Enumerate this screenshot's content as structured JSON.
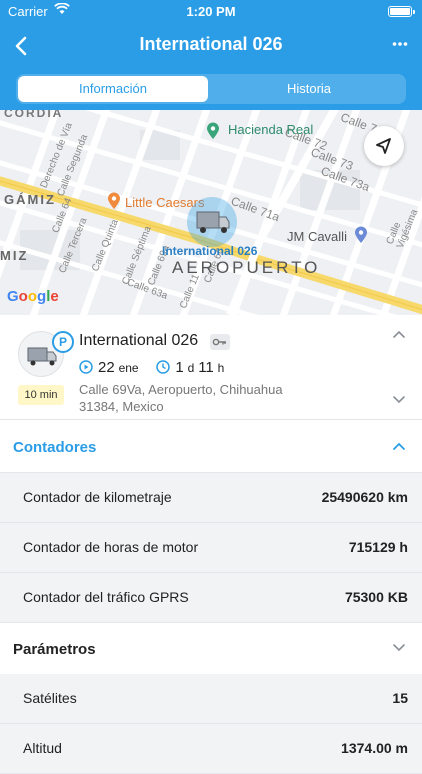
{
  "status_bar": {
    "carrier": "Carrier",
    "time": "1:20 PM"
  },
  "nav": {
    "title": "International 026",
    "back_icon": "chevron-left-icon",
    "more_icon": "ellipsis-icon"
  },
  "tabs": [
    {
      "label": "Información",
      "active": true
    },
    {
      "label": "Historia",
      "active": false
    }
  ],
  "map": {
    "streets": [
      "CORDIA",
      "Calle 7",
      "Calle 73",
      "Calle 71a",
      "Calle 72",
      "Calle 73a",
      "Derecho de Vía",
      "Calle Segunda",
      "Calle Tercera",
      "Calle Quinta",
      "Calle Séptima",
      "Calle 69a",
      "Calle 63a",
      "Calle 64",
      "Calle 67a",
      "Calle 65",
      "Calle 66",
      "Calle 11",
      "Calle Vigésima",
      "GÁMIZ",
      "MIZ"
    ],
    "places": {
      "hacienda": "Hacienda Real",
      "little_caesars": "Little Caesars",
      "jm_cavalli": "JM Cavalli"
    },
    "area": "AEROPUERTO",
    "vehicle_label": "International 026",
    "provider": "Google"
  },
  "vehicle": {
    "name": "International 026",
    "parking_badge": "P",
    "age_badge": "10 min",
    "date_day": "22",
    "date_month": "ene",
    "duration_days": "1",
    "duration_days_unit": "d",
    "duration_hours": "11",
    "duration_hours_unit": "h",
    "address_line1": "Calle 69Va, Aeropuerto, Chihuahua",
    "address_line2": "31384, Mexico"
  },
  "counters": {
    "title": "Contadores",
    "rows": [
      {
        "label": "Contador de kilometraje",
        "value": "25490620 km"
      },
      {
        "label": "Contador de horas de motor",
        "value": "715129 h"
      },
      {
        "label": "Contador del tráfico GPRS",
        "value": "75300 KB"
      }
    ]
  },
  "parameters": {
    "title": "Parámetros",
    "rows": [
      {
        "label": "Satélites",
        "value": "15"
      },
      {
        "label": "Altitud",
        "value": "1374.00 m"
      }
    ]
  },
  "colors": {
    "accent": "#2a9de6",
    "row_bg": "#f2f3f5",
    "badge_bg": "#fff7c7"
  }
}
